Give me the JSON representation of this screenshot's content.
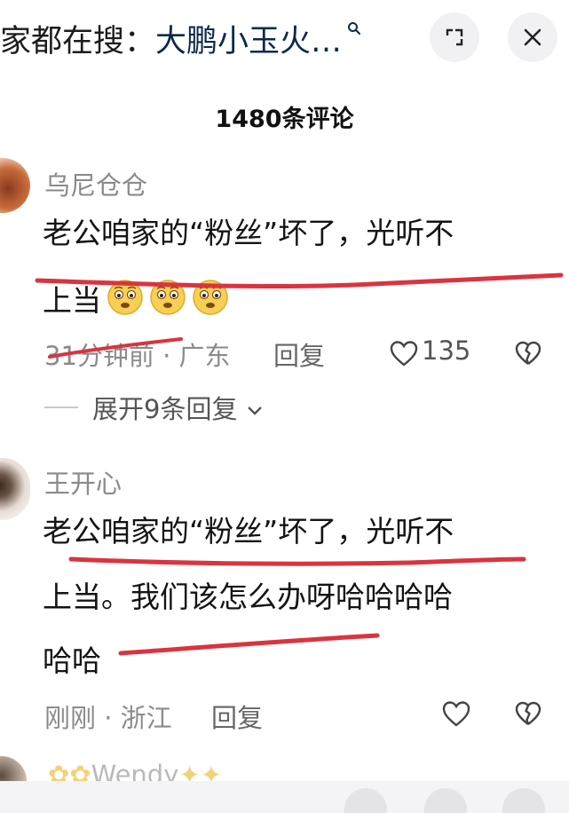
{
  "header": {
    "search_prefix": "家都在搜：",
    "search_query": "大鹏小玉火…",
    "expand_icon": "expand-icon",
    "close_icon": "close-icon"
  },
  "comments_count_title": "1480条评论",
  "comments": [
    {
      "username": "乌尼仓仓",
      "text_line1": "老公咱家的“粉丝”坏了，光听不",
      "text_line2": "上当",
      "emoji": [
        "anxious-face-emoji",
        "anxious-face-emoji",
        "anxious-face-emoji"
      ],
      "time_location": "31分钟前 · 广东",
      "reply_label": "回复",
      "like_count": "135",
      "expand_replies": "展开9条回复"
    },
    {
      "username": "王开心",
      "text_line1": "老公咱家的“粉丝”坏了，光听不",
      "text_line2": "上当。我们该怎么办呀哈哈哈哈",
      "text_line3": "哈哈",
      "time_location": "刚刚 · 浙江",
      "reply_label": "回复"
    },
    {
      "username": "Wendy"
    }
  ],
  "colors": {
    "annotation_red": "#d9343f",
    "muted_text": "#8b8b8b",
    "emoji_yellow": "#f6cf55"
  }
}
